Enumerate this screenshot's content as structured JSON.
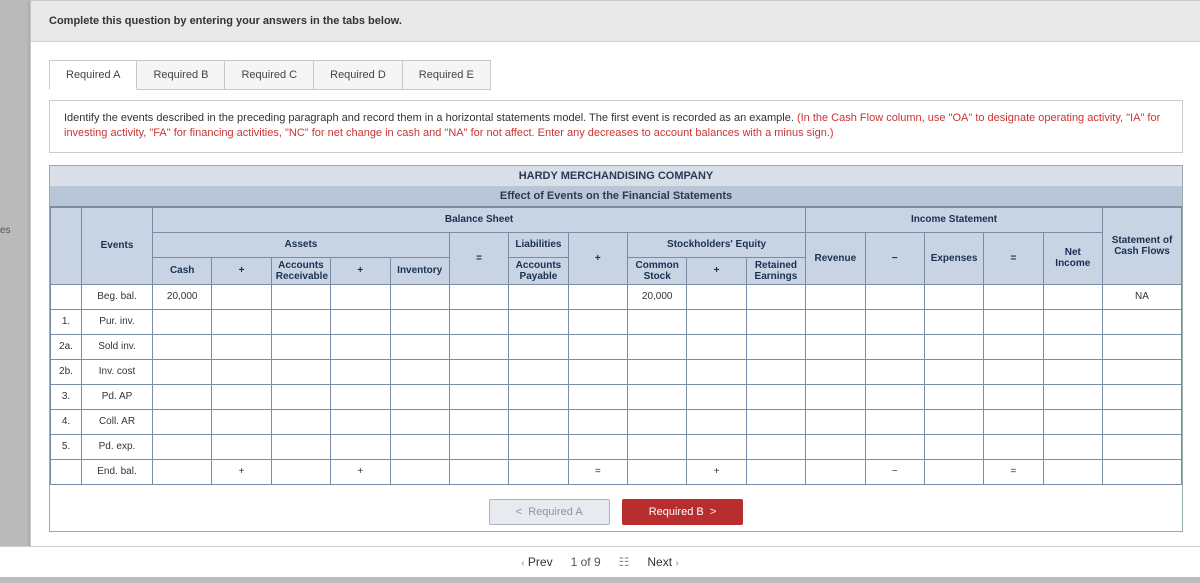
{
  "left_tab": "es",
  "prompt": "Complete this question by entering your answers in the tabs below.",
  "tabs": [
    "Required A",
    "Required B",
    "Required C",
    "Required D",
    "Required E"
  ],
  "instruction_main": "Identify the events described in the preceding paragraph and record them in a horizontal statements model. The first event is recorded as an example. ",
  "instruction_hint": "(In the Cash Flow column, use \"OA\" to designate operating activity, \"IA\" for investing activity, \"FA\" for financing activities, \"NC\" for net change in cash and \"NA\" for not affect. Enter any decreases to account balances with a minus sign.)",
  "company": "HARDY MERCHANDISING COMPANY",
  "subtitle": "Effect of Events on the Financial Statements",
  "headers": {
    "balance_sheet": "Balance Sheet",
    "income_statement": "Income Statement",
    "assets": "Assets",
    "liabilities": "Liabilities",
    "equity": "Stockholders' Equity",
    "events": "Events",
    "cash": "Cash",
    "ar": "Accounts Receivable",
    "inv": "Inventory",
    "ap": "Accounts Payable",
    "cs": "Common Stock",
    "re": "Retained Earnings",
    "rev": "Revenue",
    "exp": "Expenses",
    "ni": "Net Income",
    "cf": "Statement of Cash Flows",
    "plus": "+",
    "eq": "=",
    "minus": "−"
  },
  "rows": [
    {
      "num": "",
      "name": "Beg. bal.",
      "cash": "20,000",
      "cs": "20,000",
      "cf": "NA"
    },
    {
      "num": "1.",
      "name": "Pur. inv."
    },
    {
      "num": "2a.",
      "name": "Sold inv."
    },
    {
      "num": "2b.",
      "name": "Inv. cost"
    },
    {
      "num": "3.",
      "name": "Pd. AP"
    },
    {
      "num": "4.",
      "name": "Coll. AR"
    },
    {
      "num": "5.",
      "name": "Pd. exp."
    },
    {
      "num": "",
      "name": "End. bal.",
      "cash_sign": "+",
      "ar_sign": "+",
      "ap_sign": "=",
      "cs_sign": "+",
      "re_sign": "+",
      "exp_sign": "−",
      "ni_sign": "="
    }
  ],
  "nav": {
    "prev": "Required A",
    "next": "Required B"
  },
  "pager": {
    "prev": "Prev",
    "pos": "1 of 9",
    "next": "Next"
  }
}
